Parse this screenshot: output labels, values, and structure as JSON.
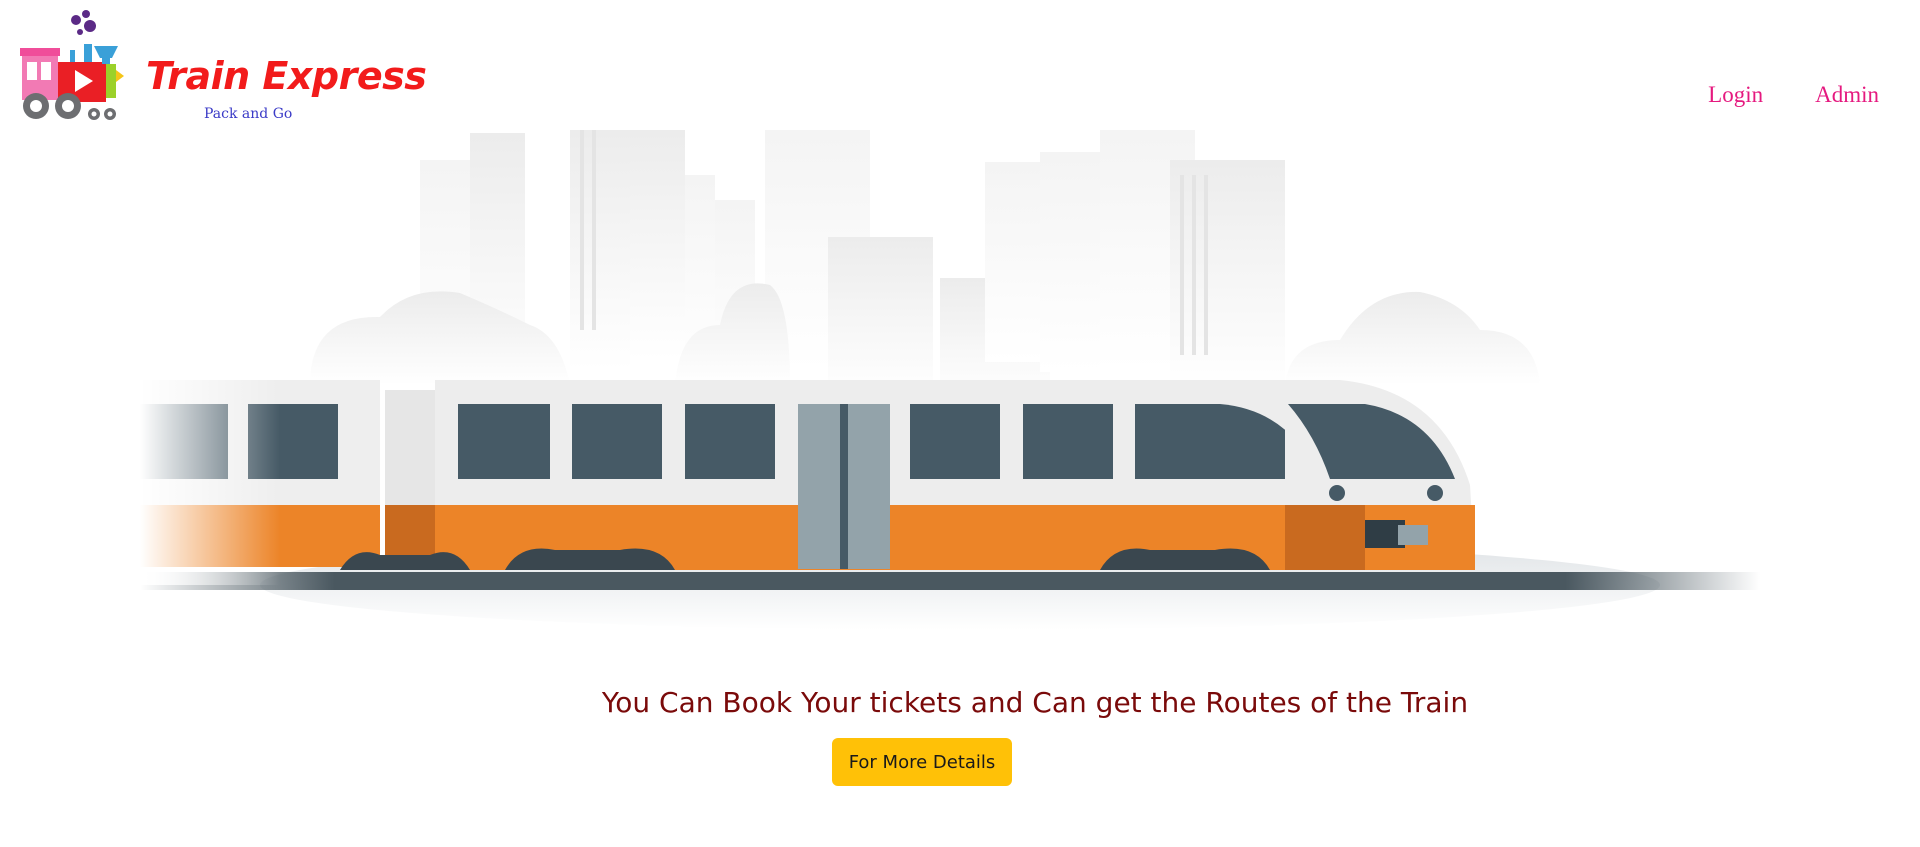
{
  "brand": {
    "title": "Train Express",
    "subtitle": "Pack and Go",
    "icon": "toy-train-logo-icon",
    "title_color": "#f21b1b",
    "subtitle_color": "#3b3bc7"
  },
  "nav": {
    "login_label": "Login",
    "admin_label": "Admin",
    "link_color": "#e5197f"
  },
  "hero": {
    "illustration": "train-city-illustration",
    "headline": "You Can Book Your tickets and Can get the Routes of the Train",
    "headline_color": "#7a0a0a",
    "cta_label": "For More Details",
    "cta_color": "#ffc107"
  }
}
